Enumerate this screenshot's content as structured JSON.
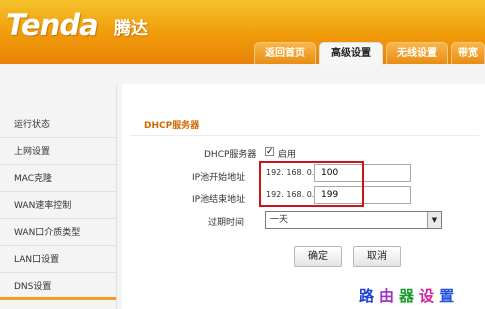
{
  "brand": {
    "name": "Tenda",
    "name_cn": "腾达"
  },
  "tabs": [
    {
      "label": "返回首页"
    },
    {
      "label": "高级设置",
      "active": true
    },
    {
      "label": "无线设置"
    },
    {
      "label": "带宽"
    }
  ],
  "sidebar": {
    "items": [
      {
        "label": "运行状态"
      },
      {
        "label": "上网设置"
      },
      {
        "label": "MAC克隆"
      },
      {
        "label": "WAN速率控制"
      },
      {
        "label": "WAN口介质类型"
      },
      {
        "label": "LAN口设置"
      },
      {
        "label": "DNS设置"
      }
    ]
  },
  "dhcp": {
    "title": "DHCP服务器",
    "server_label": "DHCP服务器",
    "enable_label": "启用",
    "enabled": true,
    "start_label": "IP池开始地址",
    "start_prefix": "192. 168. 0.",
    "start_value": "100",
    "end_label": "IP池结束地址",
    "end_prefix": "192. 168. 0.",
    "end_value": "199",
    "lease_label": "过期时间",
    "lease_value": "一天"
  },
  "buttons": {
    "ok": "确定",
    "cancel": "取消"
  },
  "watermark": {
    "text": "路由器设置",
    "colors": [
      "#1f3fd6",
      "#a030c0",
      "#1a9a2a",
      "#d020a0",
      "#2050e0"
    ]
  }
}
